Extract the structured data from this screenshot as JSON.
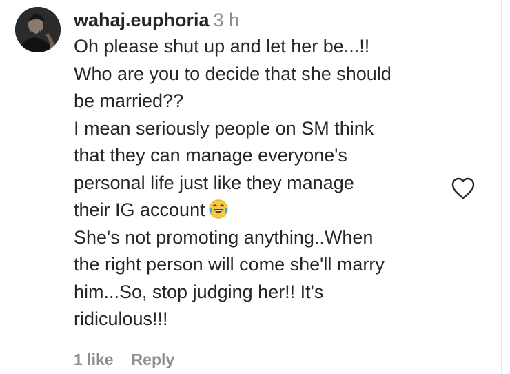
{
  "comment": {
    "username": "wahaj.euphoria",
    "time": "3 h",
    "lines": [
      "Oh please shut up and let her be...!!",
      "Who are you to decide that she should",
      "be married??",
      "I mean seriously people on SM think",
      "that they can manage everyone's",
      "personal life just like they manage",
      "their IG account",
      "She's not promoting anything..When",
      "the right person will come she'll marry",
      "him...So, stop judging her!! It's",
      "ridiculous!!!"
    ],
    "emoji": "face-with-tears-of-joy",
    "likes": "1 like",
    "reply_label": "Reply"
  },
  "icons": {
    "like": "heart-outline-icon",
    "avatar": "user-avatar"
  },
  "colors": {
    "text": "#262626",
    "muted": "#8e8e8e"
  }
}
